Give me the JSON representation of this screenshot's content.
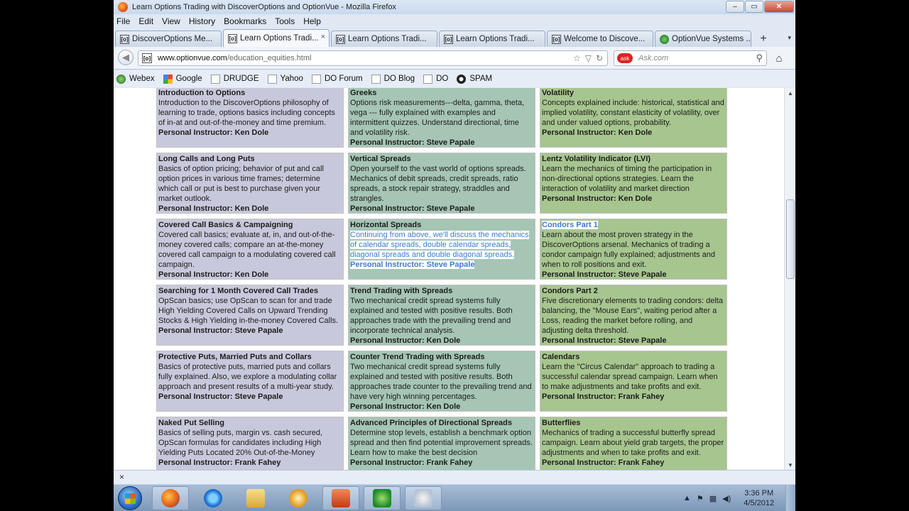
{
  "window": {
    "title": "Learn Options Trading with DiscoverOptions and OptionVue - Mozilla Firefox",
    "minimize": "–",
    "maximize": "▭",
    "close": "✕"
  },
  "menu": [
    "File",
    "Edit",
    "View",
    "History",
    "Bookmarks",
    "Tools",
    "Help"
  ],
  "tabs": [
    {
      "label": "DiscoverOptions Me...",
      "icon": "[o]",
      "active": false
    },
    {
      "label": "Learn Options Tradi...",
      "icon": "[o]",
      "active": true
    },
    {
      "label": "Learn Options Tradi...",
      "icon": "[o]",
      "active": false
    },
    {
      "label": "Learn Options Tradi...",
      "icon": "[o]",
      "active": false
    },
    {
      "label": "Welcome to Discove...",
      "icon": "[o]",
      "active": false
    },
    {
      "label": "OptionVue Systems ...",
      "icon": "ov",
      "active": false
    }
  ],
  "tab_close": "×",
  "new_tab": "+",
  "tab_list": "▾",
  "nav": {
    "back": "◀",
    "site_icon": "[o]",
    "url_domain": "www.optionvue.com",
    "url_path": "/education_equities.html",
    "url_star": "☆",
    "url_dropdown": "▽",
    "reload": "↻",
    "search_engine": "ask",
    "search_placeholder": "Ask.com",
    "search_icon": "⚲",
    "home": "⌂"
  },
  "bookmarks": [
    {
      "label": "Webex",
      "icon": "globe"
    },
    {
      "label": "Google",
      "icon": "g"
    },
    {
      "label": "DRUDGE",
      "icon": "page"
    },
    {
      "label": "Yahoo",
      "icon": "page"
    },
    {
      "label": "DO Forum",
      "icon": "page"
    },
    {
      "label": "DO Blog",
      "icon": "page"
    },
    {
      "label": "DO",
      "icon": "page"
    },
    {
      "label": "SPAM",
      "icon": "sp"
    }
  ],
  "courses": [
    {
      "title": "Introduction to Options",
      "body": "Introduction to the DiscoverOptions philosophy of learning to trade, options basics including concepts of in-at and out-of-the-money and time premium.",
      "instructor": "Personal Instructor: Ken Dole"
    },
    {
      "title": "Greeks",
      "body": "Options risk measurements---delta, gamma, theta, vega --- fully explained with examples and intermittent quizzes.  Understand directional, time and volatility risk.",
      "instructor": "Personal Instructor: Steve Papale"
    },
    {
      "title": "Volatility",
      "body": "Concepts explained include: historical, statistical and implied volatility, constant elasticity of volatility, over and under valued options, probability.",
      "instructor": "Personal Instructor: Ken Dole"
    },
    {
      "title": "Long Calls and Long Puts",
      "body": "Basics of option pricing; behavior of put and call option prices in various time frames; determine which call or put is best to purchase given your market outlook.",
      "instructor": "Personal Instructor: Ken Dole"
    },
    {
      "title": "Vertical Spreads",
      "body": "Open yourself to the vast world of options spreads.  Mechanics of debit spreads, credit spreads, ratio spreads, a stock repair strategy, straddles and strangles.",
      "instructor": "Personal Instructor: Steve Papale"
    },
    {
      "title": "Lentz Volatility Indicator (LVI)",
      "body": "Learn the mechanics of timing the participation in non-directional options strategies.  Learn the interaction of volatility and market direction",
      "instructor": "Personal Instructor: Ken Dole"
    },
    {
      "title": "Covered Call Basics & Campaigning",
      "body": "Covered call basics; evaluate at, in, and out-of-the-money covered calls; compare an at-the-money covered call campaign to a modulating covered call campaign.",
      "instructor": "Personal Instructor: Ken Dole"
    },
    {
      "title": "Horizontal Spreads",
      "body": "Continuing from above, we'll discuss the mechanics of calendar spreads, double calendar spreads, diagonal spreads and double diagonal spreads.",
      "instructor": "Personal Instructor: Steve Papale"
    },
    {
      "title": "Condors Part 1",
      "body": "Learn about the most proven strategy in the DiscoverOptions arsenal.  Mechanics of trading a condor campaign fully explained; adjustments and when to roll positions and exit.",
      "instructor": "Personal Instructor: Steve Papale"
    },
    {
      "title": "Searching for 1 Month Covered Call Trades",
      "body": "OpScan basics; use OpScan to scan for and trade High Yielding Covered Calls on Upward Trending Stocks & High Yielding in-the-money Covered Calls.",
      "instructor": "Personal Instructor: Steve Papale"
    },
    {
      "title": "Trend Trading with Spreads",
      "body": "Two mechanical credit spread systems fully explained and tested with positive results.  Both approaches trade with the prevailing trend and incorporate technical analysis.",
      "instructor": "Personal Instructor: Ken Dole"
    },
    {
      "title": "Condors Part 2",
      "body": "Five discretionary elements to trading condors: delta balancing, the \"Mouse Ears\", waiting period after a Loss, reading the market before rolling, and adjusting delta threshold.",
      "instructor": "Personal Instructor: Steve Papale"
    },
    {
      "title": "Protective Puts, Married Puts and Collars",
      "body": "Basics of protective puts, married puts and collars fully explained.  Also, we explore a modulating collar approach and present results of a multi-year study.",
      "instructor": "Personal Instructor: Steve Papale"
    },
    {
      "title": "Counter Trend Trading with Spreads",
      "body": "Two mechanical credit spread systems fully explained and tested with positive results.  Both approaches trade counter to the prevailing trend and have very high winning percentages.",
      "instructor": "Personal Instructor: Ken Dole"
    },
    {
      "title": "Calendars",
      "body": "Learn the \"Circus Calendar\" approach to trading a successful calendar spread campaign.  Learn when to make adjustments and take profits and exit.",
      "instructor": "Personal Instructor: Frank Fahey"
    },
    {
      "title": "Naked Put Selling",
      "body": "Basics of selling puts, margin vs. cash secured, OpScan formulas for candidates including High Yielding Puts Located 20% Out-of-the-Money",
      "instructor": "Personal Instructor: Frank Fahey"
    },
    {
      "title": "Advanced  Principles of Directional Spreads",
      "body": "Determine stop levels, establish a benchmark option spread and then find potential improvement spreads.   Learn how to make the best decision",
      "instructor": "Personal Instructor: Frank Fahey"
    },
    {
      "title": "Butterflies",
      "body": "Mechanics of trading a successful butterfly spread campaign.  Learn about yield grab targets, the proper adjustments and when to take profits and exit.",
      "instructor": "Personal Instructor: Frank Fahey"
    }
  ],
  "scrollbar": {
    "up": "▲",
    "down": "▼"
  },
  "findbar_close": "×",
  "taskbar": {
    "clock_time": "3:36 PM",
    "clock_date": "4/5/2012",
    "tray_up": "▲",
    "tray_flag": "⚑",
    "tray_net": "▦",
    "tray_volume": "◀)"
  }
}
